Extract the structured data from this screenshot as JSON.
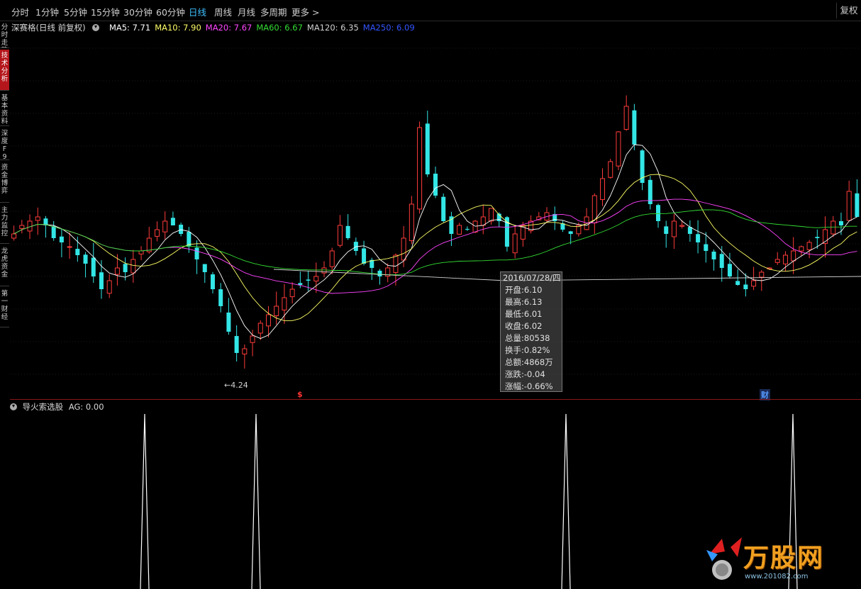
{
  "toolbar": {
    "periods": [
      "分时",
      "1分钟",
      "5分钟",
      "15分钟",
      "30分钟",
      "60分钟",
      "日线",
      "周线",
      "月线",
      "多周期",
      "更多 >"
    ],
    "active": "日线",
    "fuquan_label": "复权"
  },
  "sidebar": {
    "tabs": [
      "分时走势",
      "技术分析",
      "基本资料",
      "深度F9",
      "资金博弈",
      "主力监控",
      "龙虎资金",
      "第一财经"
    ],
    "active_index": 1
  },
  "legend": {
    "stock": "深赛格(日线 前复权)",
    "ma": [
      {
        "label": "MA5: 7.71",
        "color": "#ffffff"
      },
      {
        "label": "MA10: 7.90",
        "color": "#ffff66"
      },
      {
        "label": "MA20: 7.67",
        "color": "#ff44ff"
      },
      {
        "label": "MA60: 6.67",
        "color": "#33dd33"
      },
      {
        "label": "MA120: 6.35",
        "color": "#d0d0d0"
      },
      {
        "label": "MA250: 6.09",
        "color": "#3355ff"
      }
    ]
  },
  "tooltip": {
    "date": "2016/07/28/四",
    "rows": [
      "开盘:6.10",
      "最高:6.13",
      "最低:6.01",
      "收盘:6.02",
      "总量:80538",
      "换手:0.82%",
      "总额:4868万",
      "涨跌:-0.04",
      "涨幅:-0.66%"
    ]
  },
  "annotations": {
    "low_price": "←4.24",
    "dollar_marker": "$",
    "cai_marker": "财"
  },
  "indicator": {
    "title": "导火索选股",
    "value_label": "AG: 0.00"
  },
  "logo": {
    "brand": "万股网",
    "site": "www.201082.com"
  },
  "colors": {
    "up": "#ff3b3b",
    "down": "#33e6e6",
    "active_tab": "#b4161b",
    "separator": "#8a1818"
  },
  "chart_data": {
    "type": "candlestick",
    "price_range": [
      4.0,
      11.5
    ],
    "closes_approx": [
      7.3,
      7.5,
      7.6,
      7.7,
      7.5,
      7.2,
      7.1,
      7.0,
      6.8,
      6.6,
      6.3,
      6.0,
      6.2,
      6.5,
      6.4,
      6.7,
      6.9,
      7.2,
      7.4,
      7.6,
      7.5,
      7.3,
      7.0,
      6.7,
      6.4,
      6.0,
      5.6,
      5.0,
      4.5,
      4.6,
      4.9,
      5.2,
      5.4,
      5.6,
      5.8,
      6.0,
      6.1,
      6.2,
      6.3,
      6.5,
      6.9,
      7.5,
      7.2,
      6.9,
      6.6,
      6.5,
      6.3,
      6.5,
      6.8,
      7.2,
      8.0,
      9.8,
      8.7,
      8.2,
      7.6,
      7.3,
      7.5,
      7.4,
      7.6,
      7.7,
      7.9,
      7.6,
      7.0,
      7.3,
      7.5,
      7.6,
      7.7,
      7.8,
      7.6,
      7.4,
      7.3,
      7.5,
      7.7,
      8.2,
      8.6,
      9.0,
      9.7,
      10.3,
      9.4,
      8.5,
      8.0,
      7.6,
      7.3,
      7.6,
      7.5,
      7.3,
      7.1,
      6.9,
      6.7,
      6.5,
      6.3,
      6.1,
      6.0,
      6.2,
      6.4,
      6.5,
      6.7,
      6.8,
      6.9,
      7.0,
      7.1,
      7.2,
      7.4,
      7.6,
      7.5,
      8.3,
      7.7
    ],
    "low_annotation": 4.24
  }
}
